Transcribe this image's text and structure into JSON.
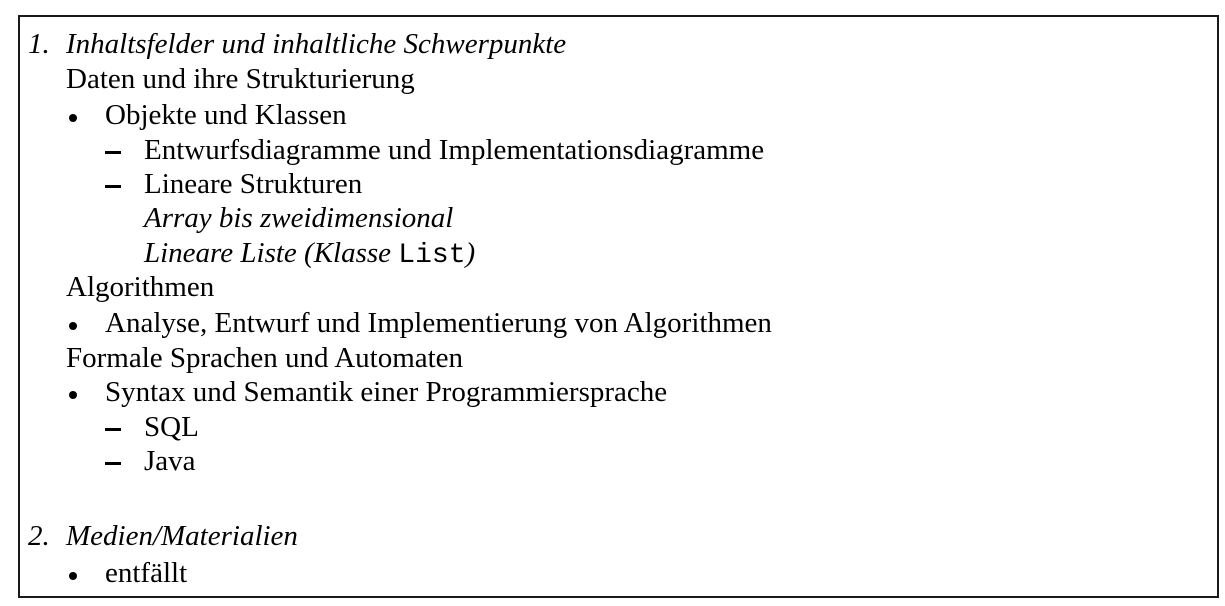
{
  "section1": {
    "number": "1.",
    "heading": "Inhaltsfelder und inhaltliche Schwerpunkte",
    "field1": {
      "title": "Daten und ihre Strukturierung",
      "item1": "Objekte und Klassen",
      "sub1": "Entwurfsdiagramme und Implementationsdiagramme",
      "sub2": "Lineare Strukturen",
      "sub2_line1": "Array bis zweidimensional",
      "sub2_line2_prefix": "Lineare Liste (Klasse ",
      "sub2_line2_code": "List",
      "sub2_line2_suffix": ")"
    },
    "field2": {
      "title": "Algorithmen",
      "item1": "Analyse, Entwurf und Implementierung von Algorithmen"
    },
    "field3": {
      "title": "Formale Sprachen und Automaten",
      "item1": "Syntax und Semantik einer Programmiersprache",
      "sub1": "SQL",
      "sub2": "Java"
    }
  },
  "section2": {
    "number": "2.",
    "heading": "Medien/Materialien",
    "item1": "entfällt"
  }
}
